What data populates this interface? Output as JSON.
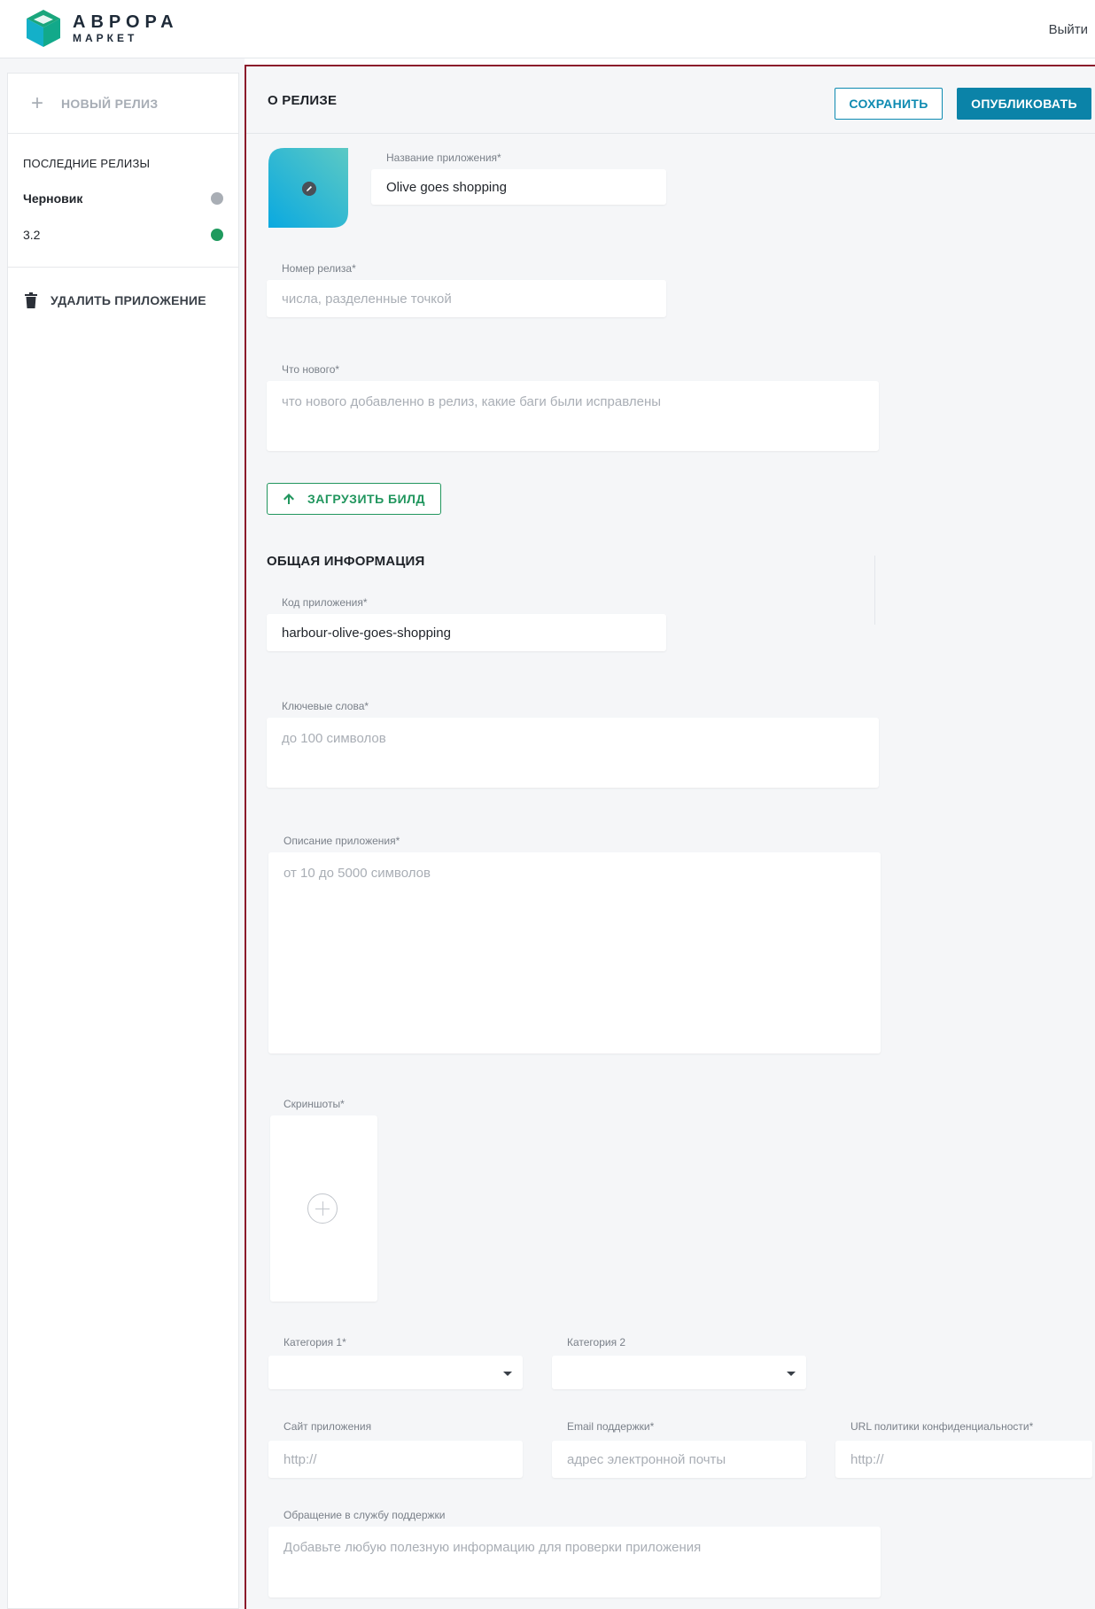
{
  "header": {
    "brand_main": "АВРОРА",
    "brand_sub": "МАРКЕТ",
    "logout_label": "Выйти"
  },
  "sidebar": {
    "new_release_label": "НОВЫЙ РЕЛИЗ",
    "recent_title": "ПОСЛЕДНИЕ РЕЛИЗЫ",
    "releases": [
      {
        "name": "Черновик",
        "status_color": "#a9aeb5"
      },
      {
        "name": "3.2",
        "status_color": "#1f9a5e"
      }
    ],
    "delete_label": "УДАЛИТЬ ПРИЛОЖЕНИЕ"
  },
  "main": {
    "title": "О РЕЛИЗЕ",
    "save_label": "СОХРАНИТЬ",
    "publish_label": "ОПУБЛИКОВАТЬ",
    "app_name": {
      "label": "Название приложения*",
      "value": "Olive goes shopping"
    },
    "release_number": {
      "label": "Номер релиза*",
      "placeholder": "числа, разделенные точкой"
    },
    "whats_new": {
      "label": "Что нового*",
      "placeholder": "что нового добавленно в релиз, какие баги были исправлены"
    },
    "upload_label": "ЗАГРУЗИТЬ БИЛД",
    "general_title": "ОБЩАЯ ИНФОРМАЦИЯ",
    "app_code": {
      "label": "Код приложения*",
      "value": "harbour-olive-goes-shopping"
    },
    "keywords": {
      "label": "Ключевые слова*",
      "placeholder": "до 100 символов"
    },
    "description": {
      "label": "Описание приложения*",
      "placeholder": "от 10 до 5000 символов"
    },
    "screenshots_label": "Скриншоты*",
    "category1": {
      "label": "Категория 1*",
      "value": ""
    },
    "category2": {
      "label": "Категория 2",
      "value": ""
    },
    "website": {
      "label": "Сайт приложения",
      "placeholder": "http://"
    },
    "support_email": {
      "label": "Email поддержки*",
      "placeholder": "адрес электронной почты"
    },
    "privacy_url": {
      "label": "URL политики конфиденциальности*",
      "placeholder": "http://"
    },
    "support_note": {
      "label": "Обращение в службу поддержки",
      "placeholder": "Добавьте любую полезную информацию для проверки приложения"
    }
  },
  "colors": {
    "accent": "#0b83a8",
    "success": "#21965e",
    "frame": "#8b1a2b"
  }
}
